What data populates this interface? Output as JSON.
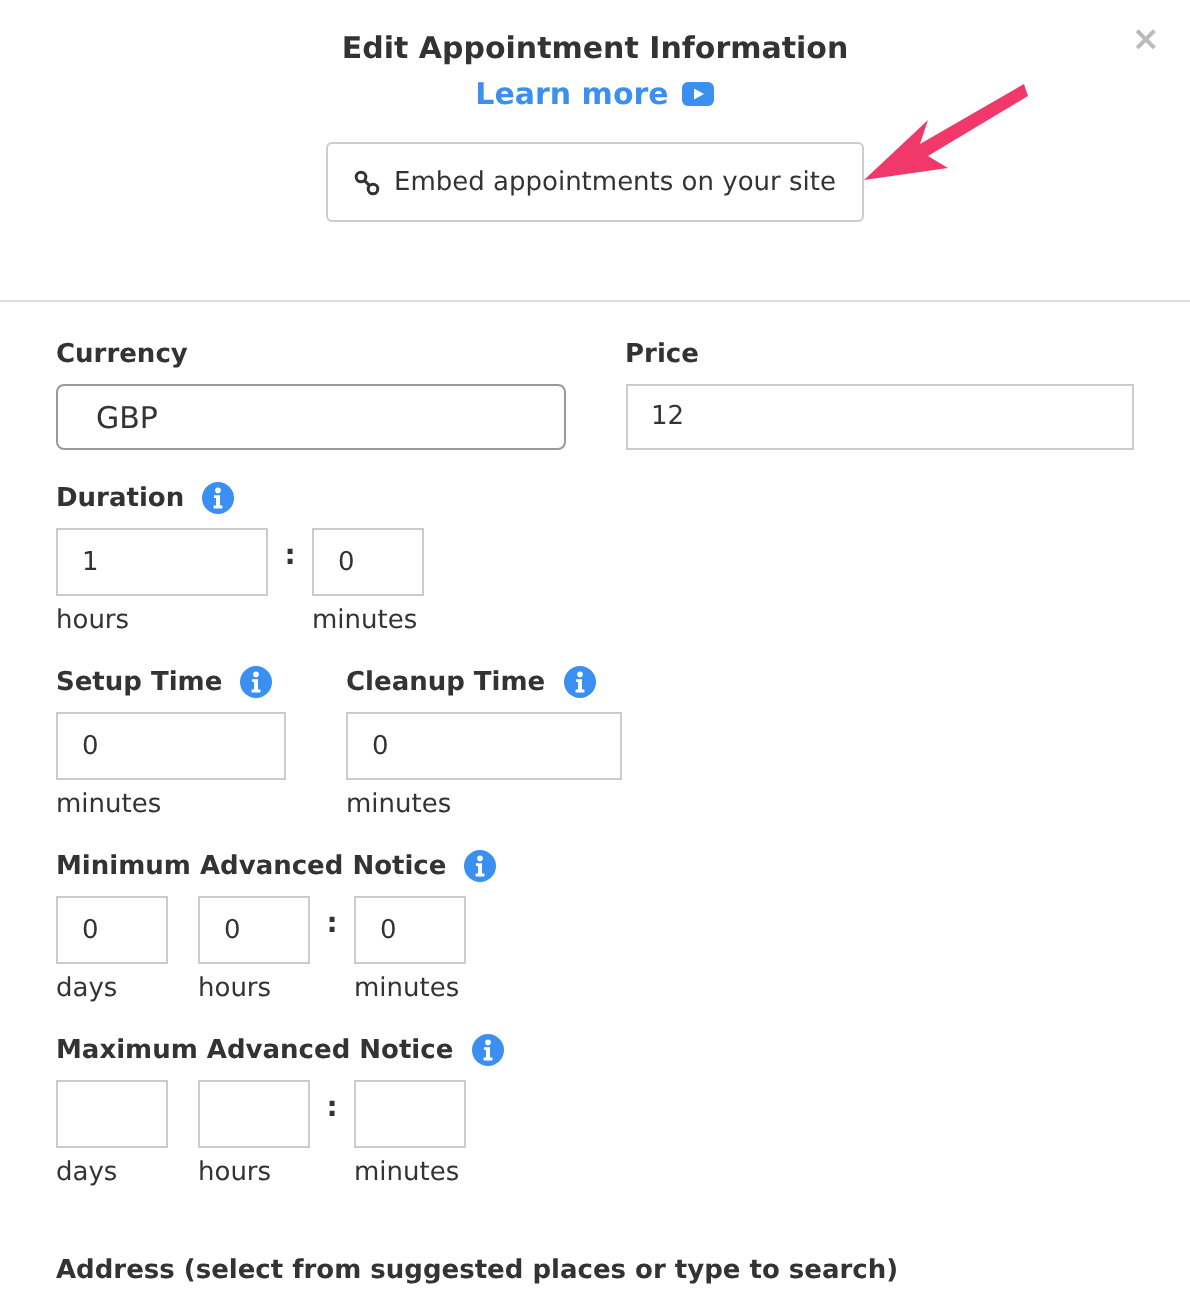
{
  "dialog": {
    "title": "Edit Appointment Information",
    "learn_more": "Learn more",
    "embed_button": "Embed appointments on your site",
    "close": "×"
  },
  "currency": {
    "label": "Currency",
    "value": "GBP"
  },
  "price": {
    "label": "Price",
    "value": "12"
  },
  "duration": {
    "label": "Duration",
    "parts": [
      {
        "value": "1",
        "unit": "hours"
      },
      {
        "value": "0",
        "unit": "minutes",
        "separator_before": ":"
      }
    ]
  },
  "setup_time": {
    "label": "Setup Time",
    "parts": [
      {
        "value": "0",
        "unit": "minutes"
      }
    ]
  },
  "cleanup_time": {
    "label": "Cleanup Time",
    "parts": [
      {
        "value": "0",
        "unit": "minutes"
      }
    ]
  },
  "min_notice": {
    "label": "Minimum Advanced Notice",
    "parts": [
      {
        "value": "0",
        "unit": "days"
      },
      {
        "value": "0",
        "unit": "hours"
      },
      {
        "value": "0",
        "unit": "minutes",
        "separator_before": ":"
      }
    ]
  },
  "max_notice": {
    "label": "Maximum Advanced Notice",
    "parts": [
      {
        "unit": "days"
      },
      {
        "unit": "hours"
      },
      {
        "unit": "minutes",
        "separator_before": ":"
      }
    ]
  },
  "address": {
    "label": "Address (select from suggested places or type to search)"
  }
}
